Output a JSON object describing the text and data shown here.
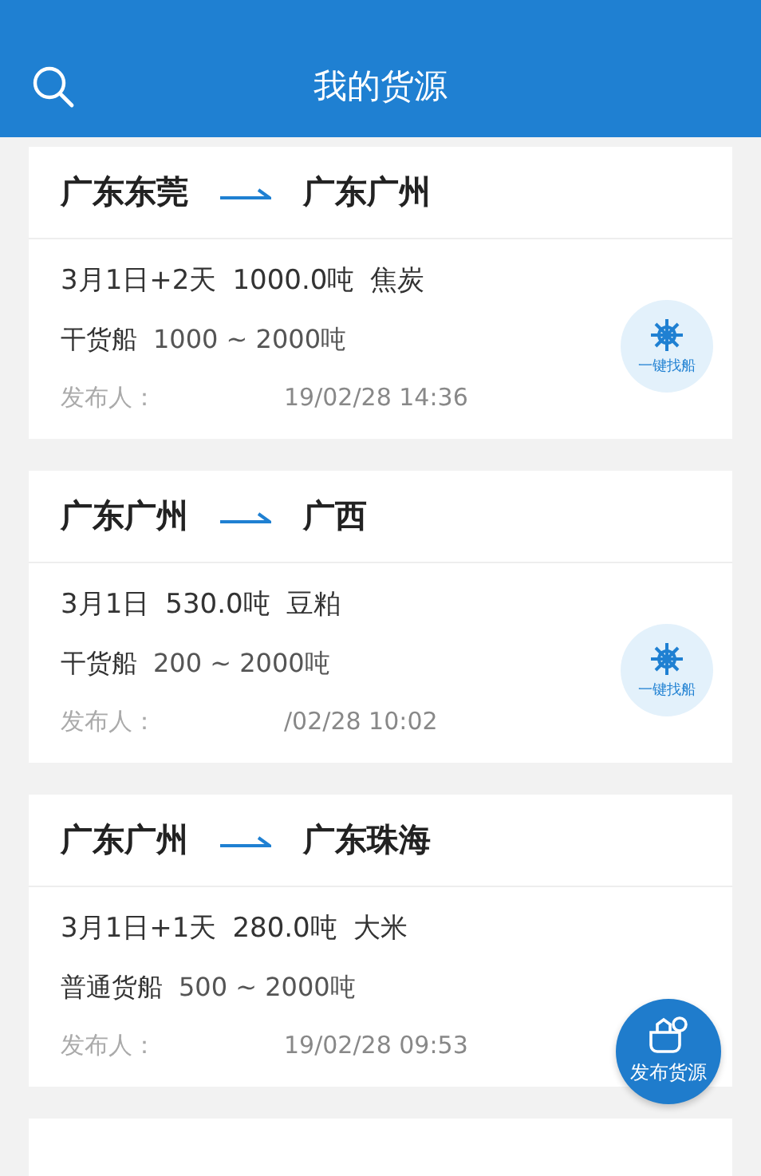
{
  "header": {
    "title": "我的货源"
  },
  "cards": [
    {
      "from": "广东东莞",
      "to": "广东广州",
      "schedule": "3月1日+2天",
      "tonnage": "1000.0吨",
      "cargo": "焦炭",
      "ship_type": "干货船",
      "ship_range": "1000 ~ 2000吨",
      "publisher_label": "发布人：",
      "published": "19/02/28 14:36",
      "find_ship": "一键找船"
    },
    {
      "from": "广东广州",
      "to": "广西",
      "schedule": "3月1日",
      "tonnage": "530.0吨",
      "cargo": "豆粕",
      "ship_type": "干货船",
      "ship_range": "200 ~ 2000吨",
      "publisher_label": "发布人：",
      "published": "/02/28 10:02",
      "find_ship": "一键找船"
    },
    {
      "from": "广东广州",
      "to": "广东珠海",
      "schedule": "3月1日+1天",
      "tonnage": "280.0吨",
      "cargo": "大米",
      "ship_type": "普通货船",
      "ship_range": "500 ~ 2000吨",
      "publisher_label": "发布人：",
      "published": "19/02/28 09:53"
    }
  ],
  "publish_button": "发布货源"
}
